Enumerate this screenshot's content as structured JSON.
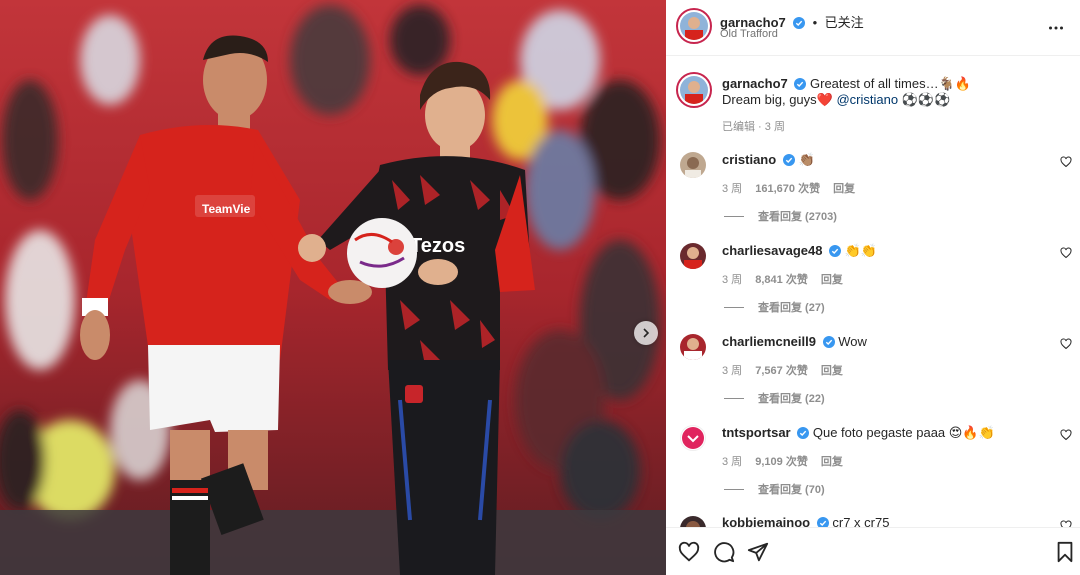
{
  "post": {
    "username": "garnacho7",
    "follow_status": "已关注",
    "separator": "•",
    "location": "Old Trafford",
    "caption_line1": "Greatest of all times…🐐🔥",
    "caption_line2_prefix": "Dream big, guys❤️ ",
    "caption_mention": "@cristiano",
    "caption_line2_suffix": " ⚽️⚽️⚽️",
    "edited_meta": "已编辑 · 3 周"
  },
  "photo": {
    "sponsor_shirt": "TeamVie",
    "sponsor_jersey": "Tezos"
  },
  "comments": [
    {
      "username": "cristiano",
      "text": "👏🏽",
      "age": "3 周",
      "likes": "161,670 次赞",
      "reply": "回复",
      "view_replies": "查看回复 (2703)"
    },
    {
      "username": "charliesavage48",
      "text": "👏👏",
      "age": "3 周",
      "likes": "8,841 次赞",
      "reply": "回复",
      "view_replies": "查看回复 (27)"
    },
    {
      "username": "charliemcneill9",
      "text": "Wow",
      "age": "3 周",
      "likes": "7,567 次赞",
      "reply": "回复",
      "view_replies": "查看回复 (22)"
    },
    {
      "username": "tntsportsar",
      "text": "Que foto pegaste paaa 😍🔥👏",
      "age": "3 周",
      "likes": "9,109 次赞",
      "reply": "回复",
      "view_replies": "查看回复 (70)"
    },
    {
      "username": "kobbiemainoo",
      "text": "cr7 x cr75",
      "age": "",
      "likes": "",
      "reply": "",
      "view_replies": ""
    }
  ],
  "colors": {
    "verified": "#3897f0",
    "red_kit": "#d6231c",
    "crowd": "#b8232a"
  },
  "icons": [
    "more-options-icon",
    "verified-icon",
    "heart-icon",
    "comment-icon",
    "share-icon",
    "save-icon",
    "chevron-right-icon"
  ]
}
